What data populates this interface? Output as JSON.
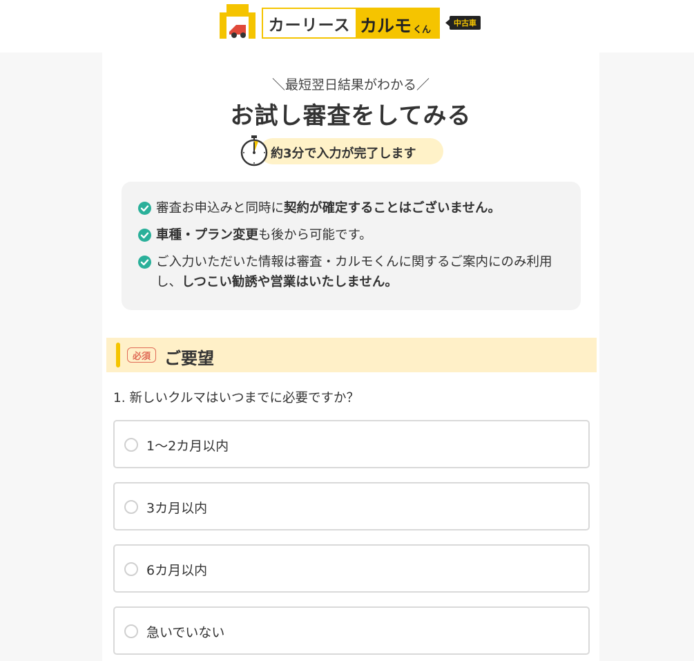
{
  "header": {
    "logo_left_text": "カーリース",
    "logo_brand": "カルモ",
    "logo_suffix": "くん",
    "logo_tag": "中古車"
  },
  "hero": {
    "sub_catch": "＼最短翌日結果がわかる／",
    "title": "お試し審査をしてみる",
    "time_note": "約3分で入力が完了します"
  },
  "notices": [
    {
      "plain": "審査お申込みと同時に",
      "bold": "契約が確定することはございません。",
      "tail": ""
    },
    {
      "plain": "",
      "bold": "車種・プラン変更",
      "tail": "も後から可能です。"
    },
    {
      "plain": "ご入力いただいた情報は審査・カルモくんに関するご案内にのみ利用し、",
      "bold": "しつこい勧誘や営業はいたしません。",
      "tail": ""
    }
  ],
  "section": {
    "required_badge": "必須",
    "title": "ご要望"
  },
  "question": {
    "text": "1. 新しいクルマはいつまでに必要ですか？",
    "options": [
      "1〜2カ月以内",
      "3カ月以内",
      "6カ月以内",
      "急いでいない"
    ]
  },
  "colors": {
    "brand_yellow": "#f5c400",
    "check_green": "#2ab09a",
    "required_red": "#e06a55",
    "section_bg": "#fff0c8"
  }
}
